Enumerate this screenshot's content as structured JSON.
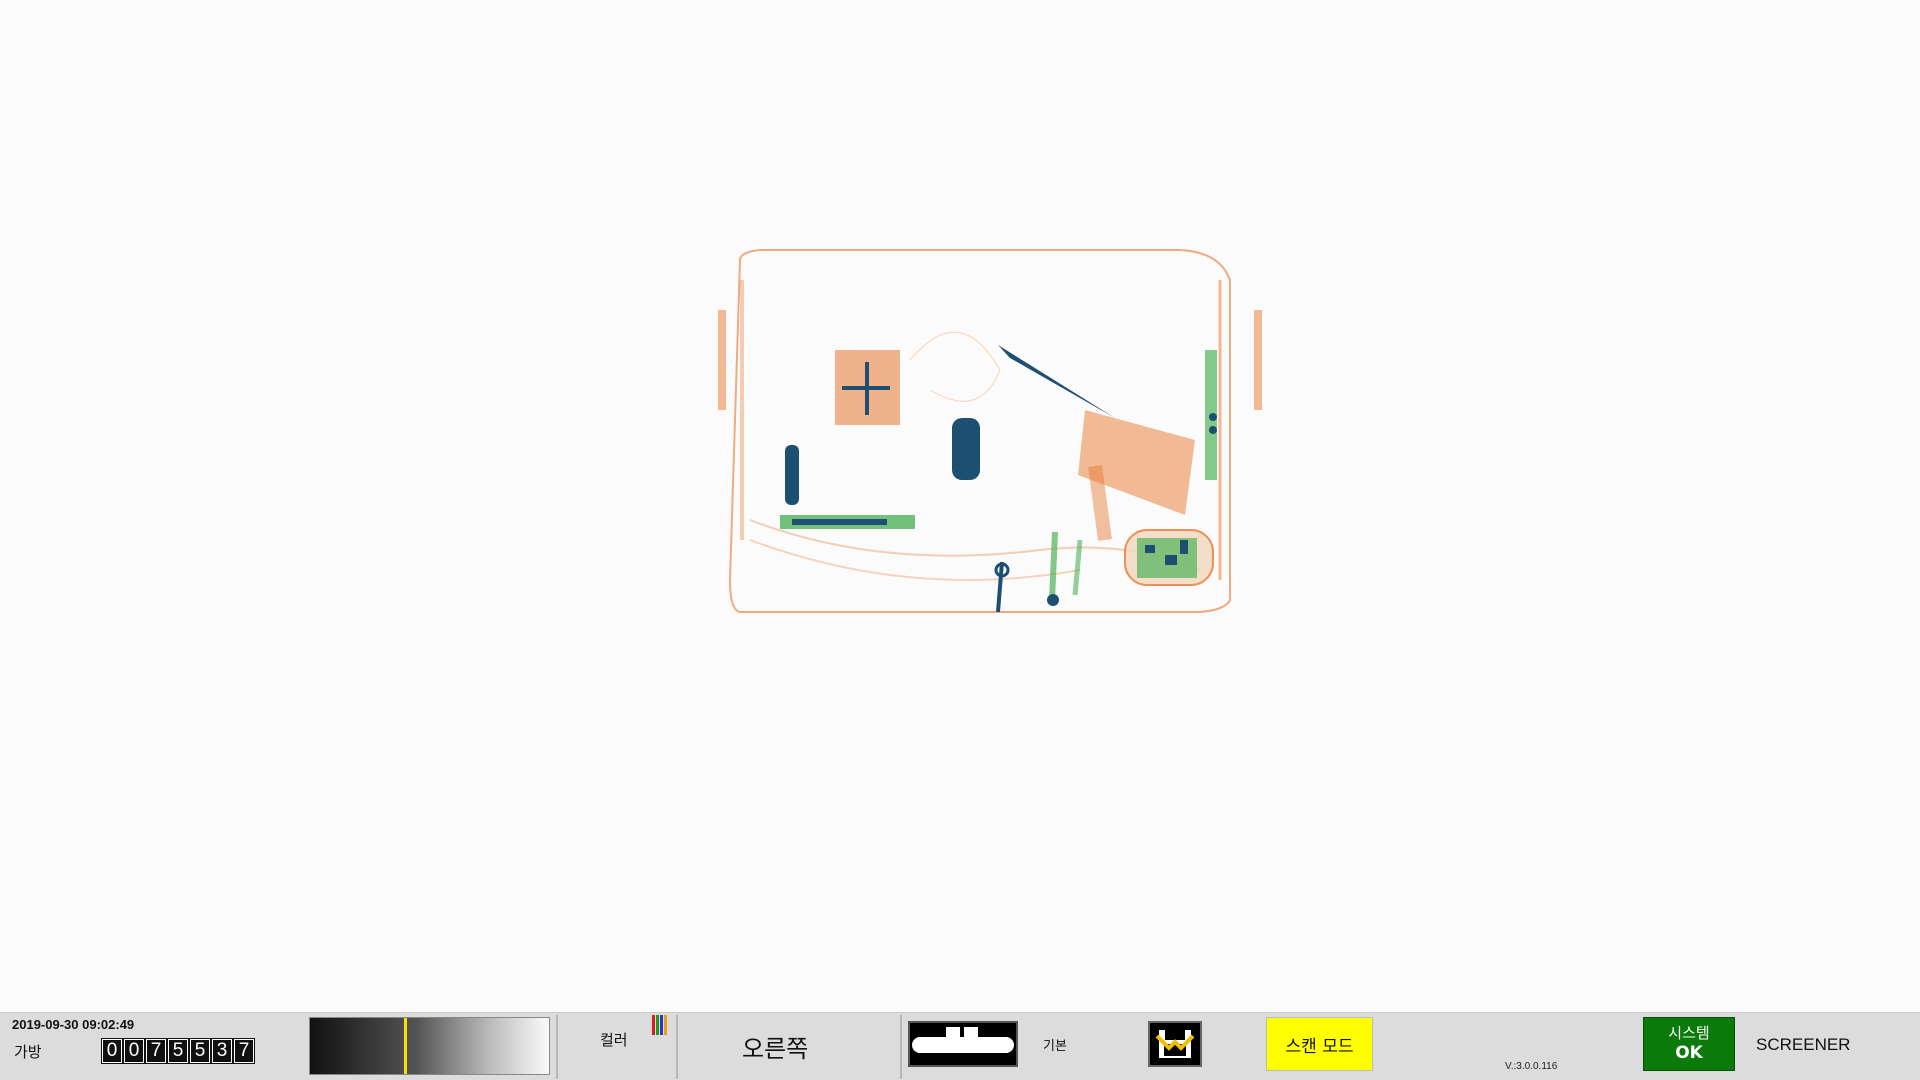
{
  "status": {
    "datetime": "2019-09-30 09:02:49",
    "bag_label": "가방",
    "bag_count_digits": [
      "0",
      "0",
      "7",
      "5",
      "5",
      "3",
      "7"
    ],
    "grayscale_level": 0.4,
    "color_label": "컬러",
    "color_bar_colors": [
      "#d02020",
      "#1e9a1e",
      "#2a36c8",
      "#e8a010"
    ],
    "direction_label": "오른쪽",
    "mode_label": "기본",
    "scan_mode_label": "스캔 모드",
    "version": "V.:3.0.0.116",
    "system_label": "시스템",
    "system_status": "OK",
    "user_role": "SCREENER"
  },
  "icons": {
    "conveyor": "conveyor-belt-icon",
    "save": "save-disk-icon"
  },
  "colors": {
    "organic": "#e8772e",
    "metal": "#1d4f73",
    "mixed": "#4fb35a",
    "scan_mode_bg": "#ffff00",
    "system_ok_bg": "#0a7a0a"
  }
}
